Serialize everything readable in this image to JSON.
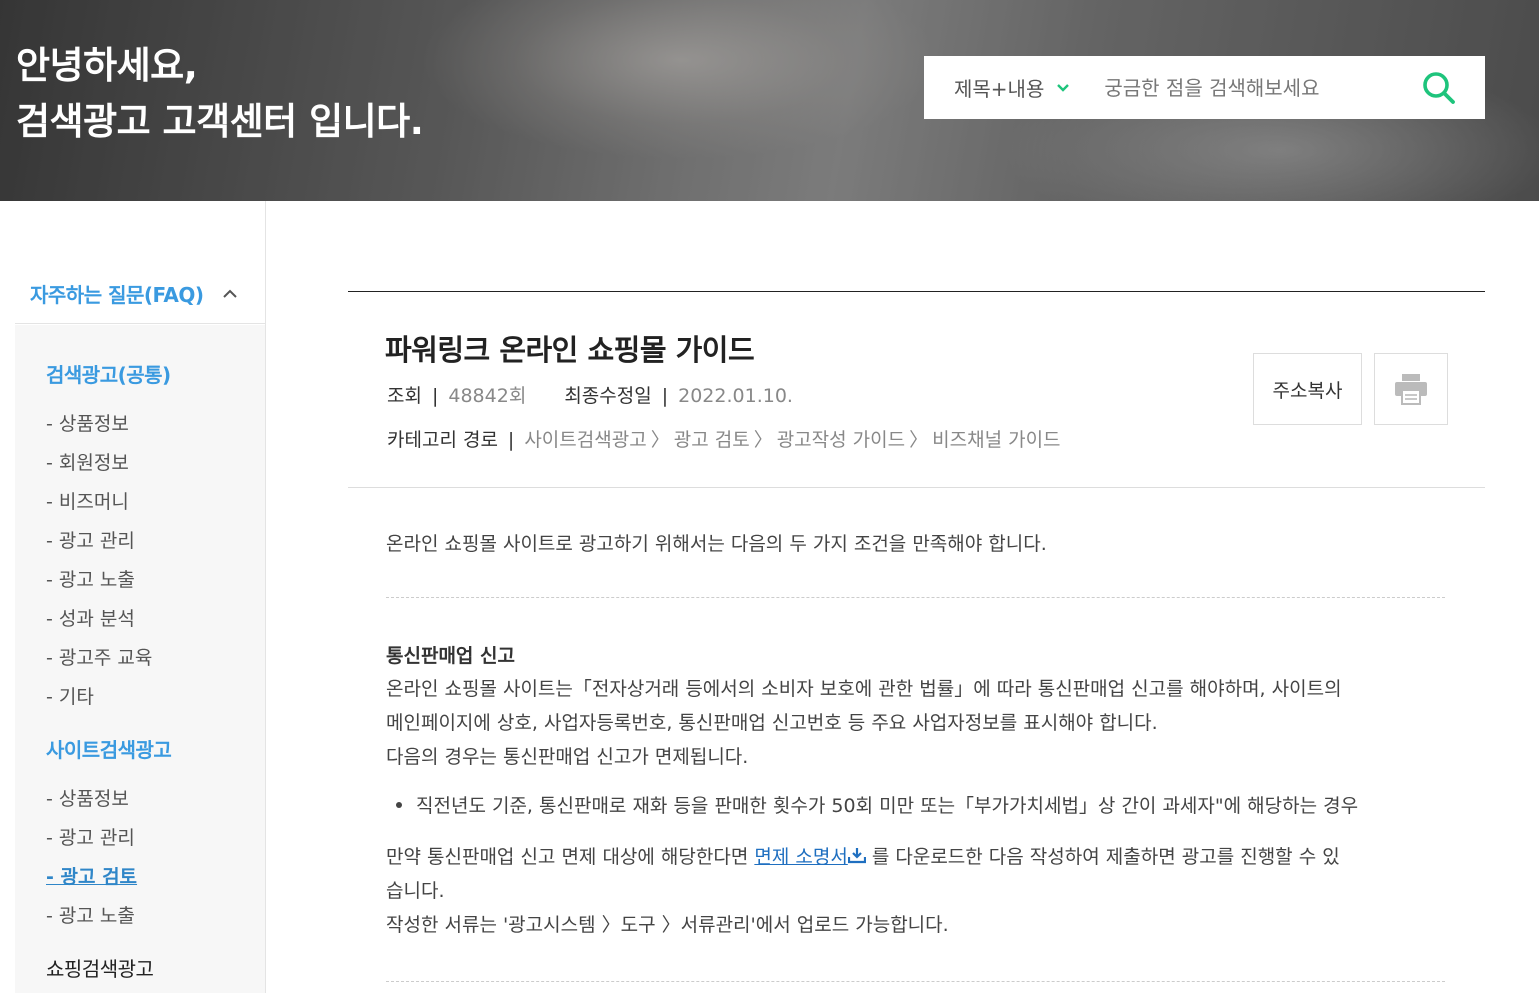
{
  "hero": {
    "line1": "안녕하세요,",
    "line2": "검색광고 고객센터 입니다."
  },
  "search": {
    "scope": "제목+내용",
    "placeholder": "궁금한 점을 검색해보세요"
  },
  "sidebar": {
    "header": "자주하는 질문(FAQ)",
    "groups": [
      {
        "label": "검색광고(공통)",
        "items": [
          "- 상품정보",
          "- 회원정보",
          "- 비즈머니",
          "- 광고 관리",
          "- 광고 노출",
          "- 성과 분석",
          "- 광고주 교육",
          "- 기타"
        ]
      },
      {
        "label": "사이트검색광고",
        "items": [
          "- 상품정보",
          "- 광고 관리",
          "- 광고 검토",
          "- 광고 노출"
        ]
      },
      {
        "label": "쇼핑검색광고",
        "items": []
      }
    ]
  },
  "article": {
    "title": "파워링크 온라인 쇼핑몰 가이드",
    "views_label": "조회",
    "views_value": "48842회",
    "updated_label": "최종수정일",
    "updated_value": "2022.01.10.",
    "category_label": "카테고리 경로",
    "category_path": [
      "사이트검색광고",
      "광고 검토",
      "광고작성 가이드",
      "비즈채널 가이드"
    ],
    "copy_button": "주소복사",
    "intro": "온라인 쇼핑몰 사이트로 광고하기 위해서는 다음의 두 가지 조건을 만족해야 합니다.",
    "section1_title": "통신판매업 신고",
    "section1_p1": "온라인 쇼핑몰 사이트는「전자상거래 등에서의 소비자 보호에 관한 법률」에 따라 통신판매업 신고를 해야하며, 사이트의",
    "section1_p2": "메인페이지에 상호, 사업자등록번호, 통신판매업 신고번호 등 주요 사업자정보를 표시해야 합니다.",
    "section1_p3": "다음의 경우는 통신판매업 신고가 면제됩니다.",
    "bullet1": "직전년도 기준, 통신판매로 재화 등을 판매한 횟수가 50회 미만 또는「부가가치세법」상 간이 과세자\"에 해당하는 경우",
    "exempt_pre": "만약 통신판매업 신고 면제 대상에 해당한다면 ",
    "exempt_link": "면제 소명서",
    "exempt_post": " 를 다운로드한 다음 작성하여 제출하면 광고를 진행할 수 있",
    "exempt_line2": "습니다.",
    "upload_note": "작성한 서류는 '광고시스템 〉도구 〉서류관리'에서 업로드 가능합니다."
  },
  "colors": {
    "accent_blue": "#3a9ae0",
    "search_green": "#1ec47c"
  }
}
